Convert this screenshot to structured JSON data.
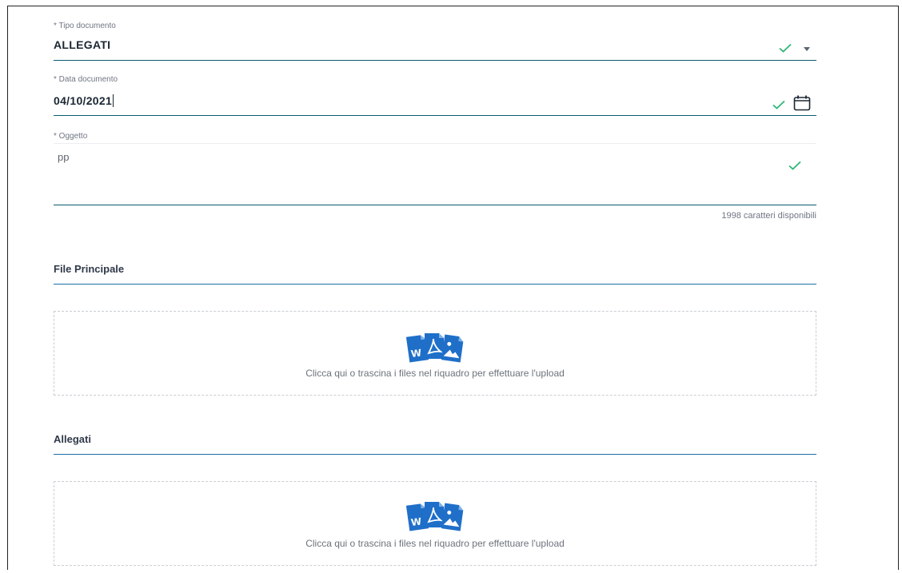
{
  "form": {
    "tipo_documento": {
      "label": "* Tipo documento",
      "value": "ALLEGATI"
    },
    "data_documento": {
      "label": "* Data documento",
      "value": "04/10/2021"
    },
    "oggetto": {
      "label": "* Oggetto",
      "value": "pp",
      "counter": "1998 caratteri disponibili"
    }
  },
  "file_principale": {
    "title": "File Principale",
    "drop_text": "Clicca qui o trascina i files nel riquadro per effettuare l'upload"
  },
  "allegati": {
    "title": "Allegati",
    "drop_text": "Clicca qui o trascina i files nel riquadro per effettuare l'upload"
  },
  "icons": {
    "valid": "check-icon",
    "dropdown": "caret-down-icon",
    "calendar": "calendar-icon",
    "upload": "file-types-icon"
  },
  "colors": {
    "valid_check": "#2fb679",
    "field_underline": "#0b5b6f",
    "section_underline": "#1e6fa6",
    "file_icon_blue": "#1f6fc9"
  }
}
